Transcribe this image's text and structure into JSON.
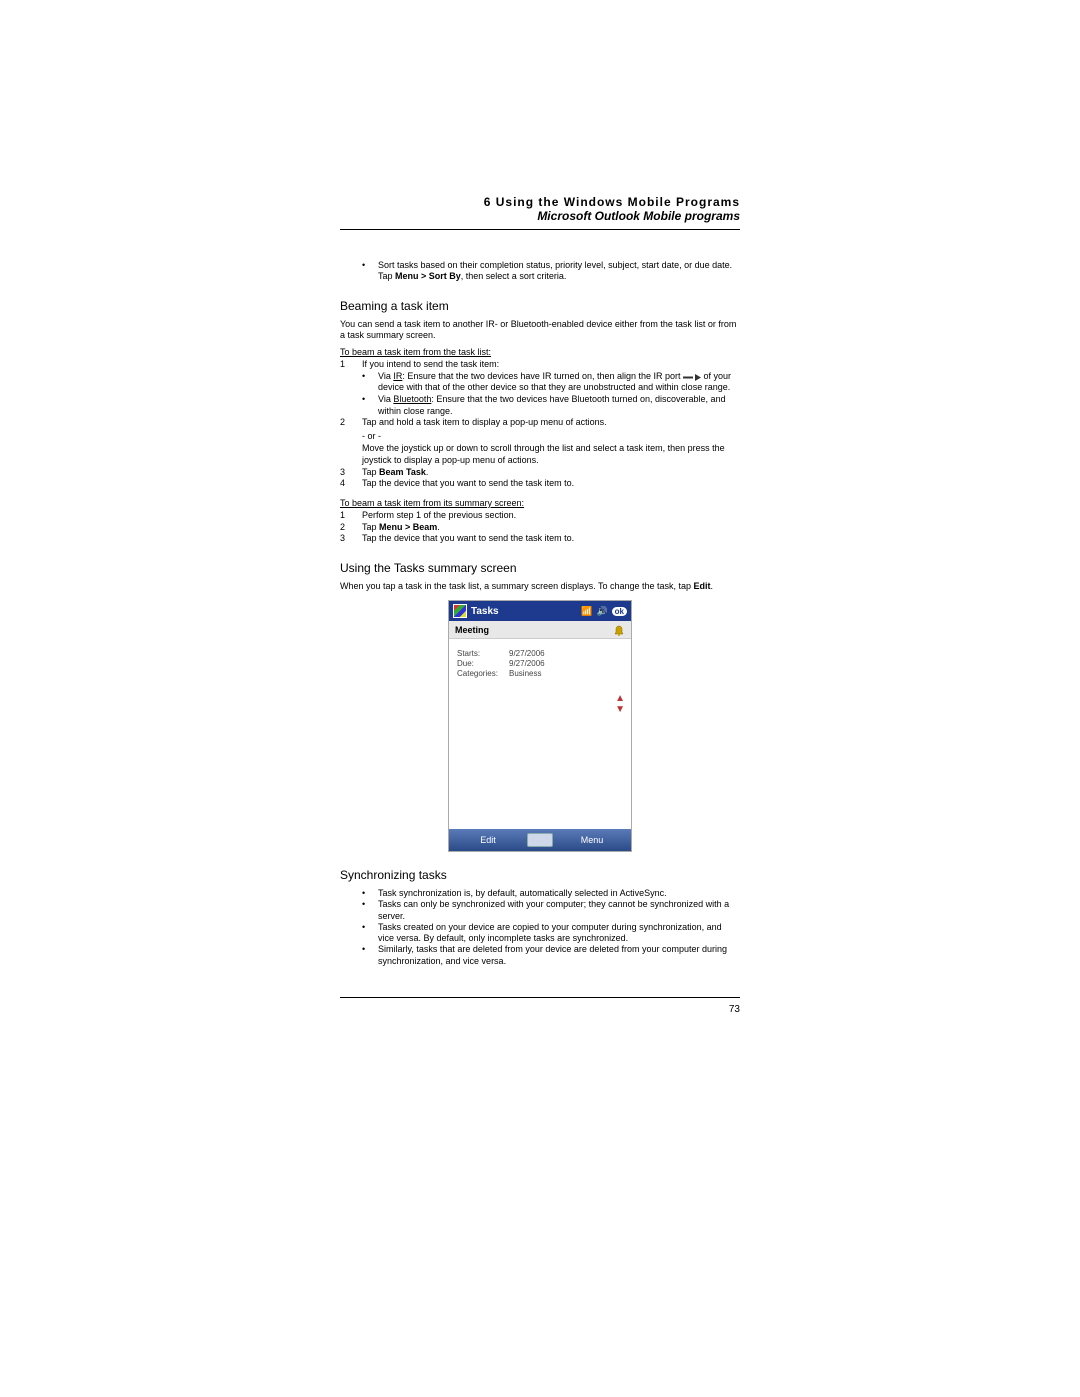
{
  "header": {
    "chapter": "6 Using the Windows Mobile Programs",
    "subtitle": "Microsoft Outlook Mobile programs"
  },
  "topBullet": {
    "pre": "Sort tasks based on their completion status, priority level, subject, start date, or due date. Tap ",
    "bold": "Menu > Sort By",
    "post": ", then select a sort criteria."
  },
  "sec1": {
    "title": "Beaming a task item",
    "intro": "You can send a task item to another IR- or Bluetooth-enabled device either from the task list or from a task summary screen.",
    "proc1Title": "To beam a task item from the task list:",
    "steps": {
      "s1": "If you intend to send the task item:",
      "s1a_pre": "Via ",
      "s1a_ul": "IR",
      "s1a_post": ": Ensure that the two devices have IR turned on, then align the IR port ",
      "s1a_tail": " of your device with that of the other device so that they are unobstructed and within close range.",
      "s1b_pre": "Via ",
      "s1b_ul": "Bluetooth",
      "s1b_post": ": Ensure that the two devices have Bluetooth turned on, discoverable, and within close range.",
      "s2": "Tap and hold a task item to display a pop-up menu of actions.",
      "or": "- or -",
      "s2b": "Move the joystick up or down to scroll through the list and select a task item, then press the joystick to display a pop-up menu of actions.",
      "s3_pre": "Tap ",
      "s3_bold": "Beam Task",
      "s3_post": ".",
      "s4": "Tap the device that you want to send the task item to."
    },
    "proc2Title": "To beam a task item from its summary screen:",
    "steps2": {
      "s1": "Perform step 1 of the previous section.",
      "s2_pre": "Tap ",
      "s2_bold": "Menu > Beam",
      "s2_post": ".",
      "s3": "Tap the device that you want to send the task item to."
    }
  },
  "sec2": {
    "title": "Using the Tasks summary screen",
    "intro_pre": "When you tap a task in the task list, a summary screen displays. To change the task, tap ",
    "intro_bold": "Edit",
    "intro_post": "."
  },
  "device": {
    "titlebar": "Tasks",
    "okLabel": "ok",
    "meeting": "Meeting",
    "rows": {
      "startsLbl": "Starts:",
      "startsVal": "9/27/2006",
      "dueLbl": "Due:",
      "dueVal": "9/27/2006",
      "catLbl": "Categories:",
      "catVal": "Business"
    },
    "footer": {
      "left": "Edit",
      "right": "Menu"
    }
  },
  "sec3": {
    "title": "Synchronizing tasks",
    "bullets": [
      "Task synchronization is, by default, automatically selected in ActiveSync.",
      "Tasks can only be synchronized with your computer; they cannot be synchronized with a server.",
      "Tasks created on your device are copied to your computer during synchronization, and vice versa. By default, only incomplete tasks are synchronized.",
      "Similarly, tasks that are deleted from your device are deleted from your computer during synchronization, and vice versa."
    ]
  },
  "pageNumber": "73"
}
